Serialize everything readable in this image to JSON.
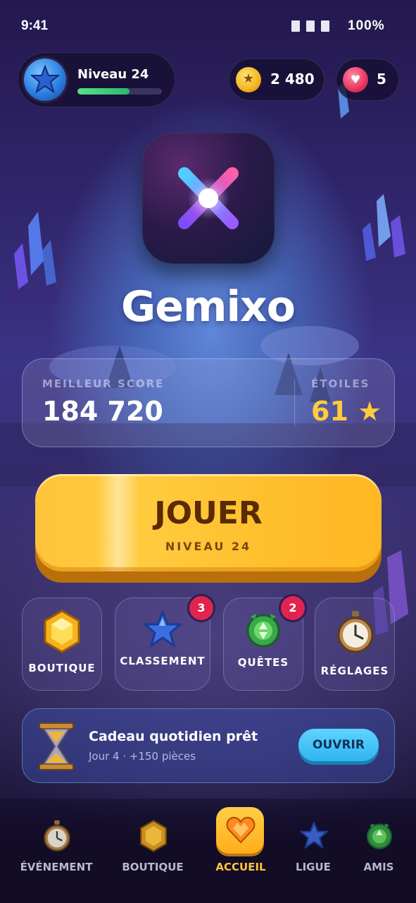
{
  "status_bar": {
    "time": "9:41",
    "battery": "100%"
  },
  "player": {
    "level_label": "Niveau 24",
    "level_progress": 0.62
  },
  "currency": {
    "coins": "2 480",
    "lives": "5"
  },
  "game": {
    "title": "Gemixo"
  },
  "stats": {
    "best_score_label": "MEILLEUR SCORE",
    "best_score": "184 720",
    "stars_label": "ÉTOILES",
    "stars": "61 ★"
  },
  "play": {
    "label": "JOUER",
    "sub_label": "NIVEAU 24"
  },
  "menu": [
    {
      "label": "BOUTIQUE",
      "icon": "gem-icon",
      "badge": ""
    },
    {
      "label": "CLASSEMENT",
      "icon": "star-icon",
      "badge": "3"
    },
    {
      "label": "QUÊTES",
      "icon": "quest-gem-icon",
      "badge": "2"
    },
    {
      "label": "RÉGLAGES",
      "icon": "stopwatch-icon",
      "badge": ""
    }
  ],
  "daily_gift": {
    "title": "Cadeau quotidien prêt",
    "subtitle": "Jour 4 · +150 pièces",
    "button": "OUVRIR",
    "icon": "hourglass-icon"
  },
  "nav": [
    {
      "label": "ÉVÉNEMENT",
      "icon": "stopwatch-icon",
      "active": false
    },
    {
      "label": "BOUTIQUE",
      "icon": "gem-icon",
      "active": false
    },
    {
      "label": "ACCUEIL",
      "icon": "heart-gem-icon",
      "active": true
    },
    {
      "label": "LIGUE",
      "icon": "star-icon",
      "active": false
    },
    {
      "label": "AMIS",
      "icon": "friends-gem-icon",
      "active": false
    }
  ],
  "colors": {
    "accent_yellow": "#FFC43A",
    "badge_red": "#E1244F",
    "gift_button": "#2FB4EE",
    "progress_green": "#2FB869",
    "active_nav_label": "#FFC43A"
  }
}
